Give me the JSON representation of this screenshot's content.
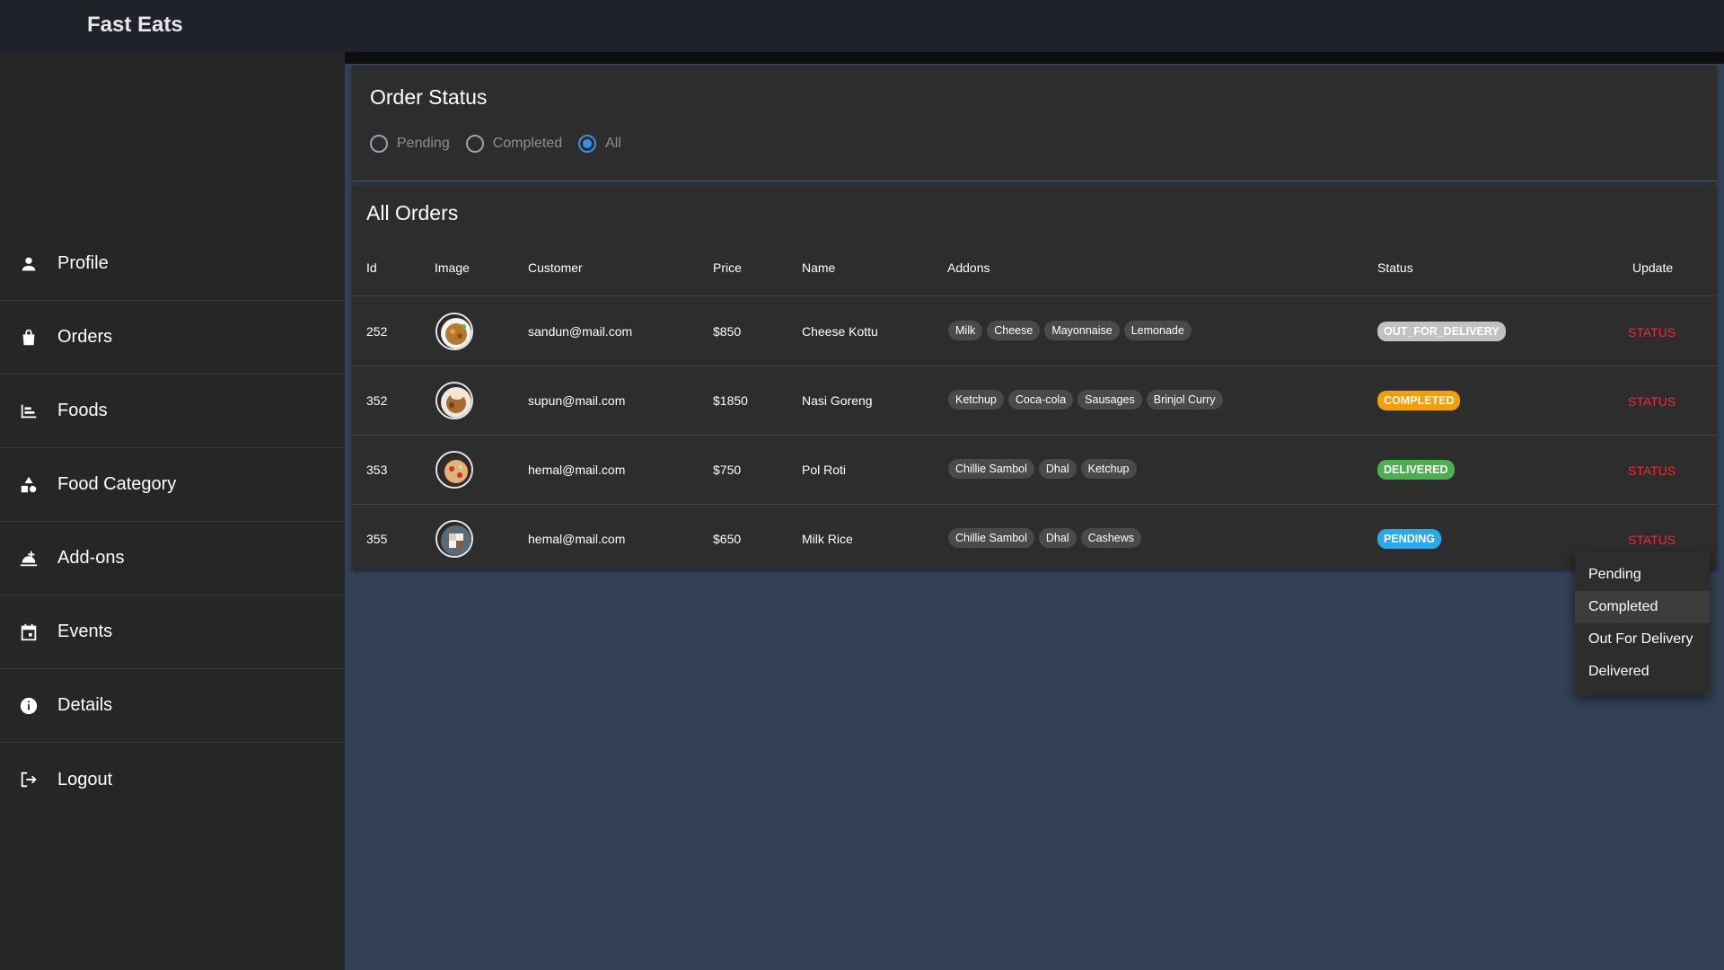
{
  "app": {
    "brand": "Fast Eats"
  },
  "sidebar": {
    "items": [
      {
        "label": "Profile",
        "icon": "person-icon"
      },
      {
        "label": "Orders",
        "icon": "shopping-bag-icon"
      },
      {
        "label": "Foods",
        "icon": "food-icon"
      },
      {
        "label": "Food Category",
        "icon": "category-icon"
      },
      {
        "label": "Add-ons",
        "icon": "addons-icon"
      },
      {
        "label": "Events",
        "icon": "calendar-icon"
      },
      {
        "label": "Details",
        "icon": "info-icon"
      },
      {
        "label": "Logout",
        "icon": "logout-icon"
      }
    ]
  },
  "order_status": {
    "title": "Order Status",
    "options": [
      "Pending",
      "Completed",
      "All"
    ],
    "selected": "All",
    "accent": "#3b8fe6"
  },
  "orders": {
    "title": "All Orders",
    "columns": [
      "Id",
      "Image",
      "Customer",
      "Price",
      "Name",
      "Addons",
      "Status",
      "Update"
    ],
    "rows": [
      {
        "id": "252",
        "image": "cheese-kottu-thumbnail",
        "customer": "sandun@mail.com",
        "price": "$850",
        "name": "Cheese Kottu",
        "addons": [
          "Milk",
          "Cheese",
          "Mayonnaise",
          "Lemonade"
        ],
        "status": "OUT_FOR_DELIVERY",
        "status_color": "#9e9e9e",
        "update": "STATUS"
      },
      {
        "id": "352",
        "image": "nasi-goreng-thumbnail",
        "customer": "supun@mail.com",
        "price": "$1850",
        "name": "Nasi Goreng",
        "addons": [
          "Ketchup",
          "Coca-cola",
          "Sausages",
          "Brinjol Curry"
        ],
        "status": "COMPLETED",
        "status_color": "#f59e0b",
        "update": "STATUS"
      },
      {
        "id": "353",
        "image": "pol-roti-thumbnail",
        "customer": "hemal@mail.com",
        "price": "$750",
        "name": "Pol Roti",
        "addons": [
          "Chillie Sambol",
          "Dhal",
          "Ketchup"
        ],
        "status": "DELIVERED",
        "status_color": "#4caf50",
        "update": "STATUS"
      },
      {
        "id": "355",
        "image": "milk-rice-thumbnail",
        "customer": "hemal@mail.com",
        "price": "$650",
        "name": "Milk Rice",
        "addons": [
          "Chillie Sambol",
          "Dhal",
          "Cashews"
        ],
        "status": "PENDING",
        "status_color": "#29a9e8",
        "update": "STATUS"
      }
    ]
  },
  "status_menu": {
    "items": [
      "Pending",
      "Completed",
      "Out For Delivery",
      "Delivered"
    ],
    "highlighted": "Completed"
  },
  "colors": {
    "update_link": "#ef2a3c",
    "sidebar_bg": "#262626",
    "main_bg": "#334155"
  }
}
